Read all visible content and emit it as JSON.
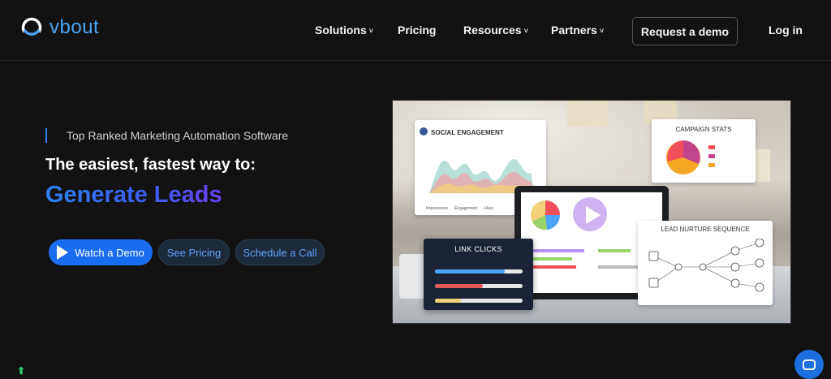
{
  "brand": {
    "name": "vbout",
    "color": "#4aa3f5"
  },
  "nav": {
    "items": [
      {
        "label": "Solutions",
        "dropdown": true
      },
      {
        "label": "Pricing",
        "dropdown": false
      },
      {
        "label": "Resources",
        "dropdown": true
      },
      {
        "label": "Partners",
        "dropdown": true
      }
    ],
    "request_demo": "Request a demo",
    "login": "Log in"
  },
  "hero": {
    "eyebrow": "Top Ranked Marketing Automation Software",
    "headline": "The easiest, fastest way to:",
    "highlight": "Generate Leads",
    "ctas": {
      "watch": "Watch a Demo",
      "pricing": "See Pricing",
      "call": "Schedule a Call"
    }
  },
  "hero_image": {
    "social_title": "SOCIAL ENGAGEMENT",
    "social_legend": [
      "Impressions",
      "Engagement",
      "Likes"
    ],
    "campaign_title": "CAMPAIGN STATS",
    "link_clicks_title": "LINK CLICKS",
    "lead_nurture_title": "LEAD NURTURE SEQUENCE",
    "link_clicks_fill": [
      0.8,
      0.55,
      0.3
    ]
  },
  "colors": {
    "accent": "#1a6cf2",
    "background": "#121212",
    "gradient_start": "#2f80f0",
    "gradient_end": "#6a3ef4"
  },
  "icons": {
    "chat": "chat-bubble-icon",
    "play": "play-icon"
  }
}
